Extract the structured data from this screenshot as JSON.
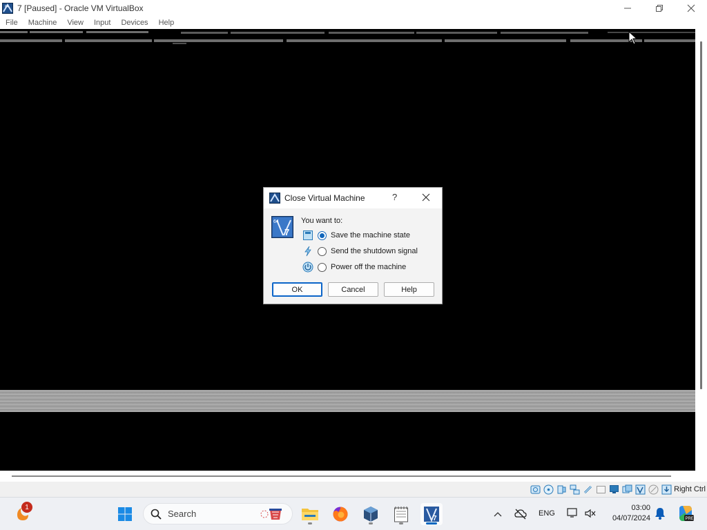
{
  "window": {
    "title": "7 [Paused] - Oracle VM VirtualBox",
    "controls": [
      "minimize-icon",
      "restore-icon",
      "close-icon"
    ]
  },
  "menu": [
    "File",
    "Machine",
    "View",
    "Input",
    "Devices",
    "Help"
  ],
  "dialog": {
    "title": "Close Virtual Machine",
    "help_glyph": "?",
    "prompt": "You want to:",
    "options": [
      {
        "label": "Save the machine state",
        "icon": "save-state-icon",
        "selected": true
      },
      {
        "label": "Send the shutdown signal",
        "icon": "shutdown-signal-icon",
        "selected": false
      },
      {
        "label": "Power off the machine",
        "icon": "power-icon",
        "selected": false
      }
    ],
    "buttons": {
      "ok": "OK",
      "cancel": "Cancel",
      "help": "Help"
    }
  },
  "statusbar": {
    "icons": [
      "hard-disk-icon",
      "optical-drive-icon",
      "audio-icon",
      "network-icon",
      "usb-icon",
      "shared-folders-icon",
      "display-icon",
      "recording-icon",
      "cpu-virtualization-icon",
      "mouse-integration-icon",
      "keyboard-capture-icon"
    ],
    "host_key": "Right Ctrl"
  },
  "taskbar": {
    "notification_count": "1",
    "search_placeholder": "Search",
    "apps": [
      "windows-start-icon",
      "file-explorer-icon",
      "firefox-icon",
      "virtualbox-manager-icon",
      "notepad-icon",
      "virtualbox-vm-icon"
    ],
    "language": "ENG",
    "time": "03:00",
    "date": "04/07/2024"
  },
  "colors": {
    "accent": "#0067c0",
    "dialog_bg": "#f3f3f3",
    "vm_bg": "#000000",
    "badge": "#c42b1c"
  }
}
